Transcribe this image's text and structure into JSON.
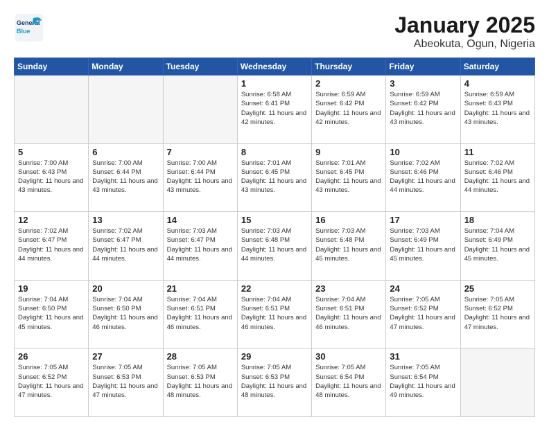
{
  "header": {
    "logo_general": "General",
    "logo_blue": "Blue",
    "title": "January 2025",
    "subtitle": "Abeokuta, Ogun, Nigeria"
  },
  "weekdays": [
    "Sunday",
    "Monday",
    "Tuesday",
    "Wednesday",
    "Thursday",
    "Friday",
    "Saturday"
  ],
  "weeks": [
    [
      {
        "day": "",
        "info": "",
        "empty": true
      },
      {
        "day": "",
        "info": "",
        "empty": true
      },
      {
        "day": "",
        "info": "",
        "empty": true
      },
      {
        "day": "1",
        "info": "Sunrise: 6:58 AM\nSunset: 6:41 PM\nDaylight: 11 hours and 42 minutes."
      },
      {
        "day": "2",
        "info": "Sunrise: 6:59 AM\nSunset: 6:42 PM\nDaylight: 11 hours and 42 minutes."
      },
      {
        "day": "3",
        "info": "Sunrise: 6:59 AM\nSunset: 6:42 PM\nDaylight: 11 hours and 43 minutes."
      },
      {
        "day": "4",
        "info": "Sunrise: 6:59 AM\nSunset: 6:43 PM\nDaylight: 11 hours and 43 minutes."
      }
    ],
    [
      {
        "day": "5",
        "info": "Sunrise: 7:00 AM\nSunset: 6:43 PM\nDaylight: 11 hours and 43 minutes."
      },
      {
        "day": "6",
        "info": "Sunrise: 7:00 AM\nSunset: 6:44 PM\nDaylight: 11 hours and 43 minutes."
      },
      {
        "day": "7",
        "info": "Sunrise: 7:00 AM\nSunset: 6:44 PM\nDaylight: 11 hours and 43 minutes."
      },
      {
        "day": "8",
        "info": "Sunrise: 7:01 AM\nSunset: 6:45 PM\nDaylight: 11 hours and 43 minutes."
      },
      {
        "day": "9",
        "info": "Sunrise: 7:01 AM\nSunset: 6:45 PM\nDaylight: 11 hours and 43 minutes."
      },
      {
        "day": "10",
        "info": "Sunrise: 7:02 AM\nSunset: 6:46 PM\nDaylight: 11 hours and 44 minutes."
      },
      {
        "day": "11",
        "info": "Sunrise: 7:02 AM\nSunset: 6:46 PM\nDaylight: 11 hours and 44 minutes."
      }
    ],
    [
      {
        "day": "12",
        "info": "Sunrise: 7:02 AM\nSunset: 6:47 PM\nDaylight: 11 hours and 44 minutes."
      },
      {
        "day": "13",
        "info": "Sunrise: 7:02 AM\nSunset: 6:47 PM\nDaylight: 11 hours and 44 minutes."
      },
      {
        "day": "14",
        "info": "Sunrise: 7:03 AM\nSunset: 6:47 PM\nDaylight: 11 hours and 44 minutes."
      },
      {
        "day": "15",
        "info": "Sunrise: 7:03 AM\nSunset: 6:48 PM\nDaylight: 11 hours and 44 minutes."
      },
      {
        "day": "16",
        "info": "Sunrise: 7:03 AM\nSunset: 6:48 PM\nDaylight: 11 hours and 45 minutes."
      },
      {
        "day": "17",
        "info": "Sunrise: 7:03 AM\nSunset: 6:49 PM\nDaylight: 11 hours and 45 minutes."
      },
      {
        "day": "18",
        "info": "Sunrise: 7:04 AM\nSunset: 6:49 PM\nDaylight: 11 hours and 45 minutes."
      }
    ],
    [
      {
        "day": "19",
        "info": "Sunrise: 7:04 AM\nSunset: 6:50 PM\nDaylight: 11 hours and 45 minutes."
      },
      {
        "day": "20",
        "info": "Sunrise: 7:04 AM\nSunset: 6:50 PM\nDaylight: 11 hours and 46 minutes."
      },
      {
        "day": "21",
        "info": "Sunrise: 7:04 AM\nSunset: 6:51 PM\nDaylight: 11 hours and 46 minutes."
      },
      {
        "day": "22",
        "info": "Sunrise: 7:04 AM\nSunset: 6:51 PM\nDaylight: 11 hours and 46 minutes."
      },
      {
        "day": "23",
        "info": "Sunrise: 7:04 AM\nSunset: 6:51 PM\nDaylight: 11 hours and 46 minutes."
      },
      {
        "day": "24",
        "info": "Sunrise: 7:05 AM\nSunset: 6:52 PM\nDaylight: 11 hours and 47 minutes."
      },
      {
        "day": "25",
        "info": "Sunrise: 7:05 AM\nSunset: 6:52 PM\nDaylight: 11 hours and 47 minutes."
      }
    ],
    [
      {
        "day": "26",
        "info": "Sunrise: 7:05 AM\nSunset: 6:52 PM\nDaylight: 11 hours and 47 minutes."
      },
      {
        "day": "27",
        "info": "Sunrise: 7:05 AM\nSunset: 6:53 PM\nDaylight: 11 hours and 47 minutes."
      },
      {
        "day": "28",
        "info": "Sunrise: 7:05 AM\nSunset: 6:53 PM\nDaylight: 11 hours and 48 minutes."
      },
      {
        "day": "29",
        "info": "Sunrise: 7:05 AM\nSunset: 6:53 PM\nDaylight: 11 hours and 48 minutes."
      },
      {
        "day": "30",
        "info": "Sunrise: 7:05 AM\nSunset: 6:54 PM\nDaylight: 11 hours and 48 minutes."
      },
      {
        "day": "31",
        "info": "Sunrise: 7:05 AM\nSunset: 6:54 PM\nDaylight: 11 hours and 49 minutes."
      },
      {
        "day": "",
        "info": "",
        "empty": true
      }
    ]
  ]
}
